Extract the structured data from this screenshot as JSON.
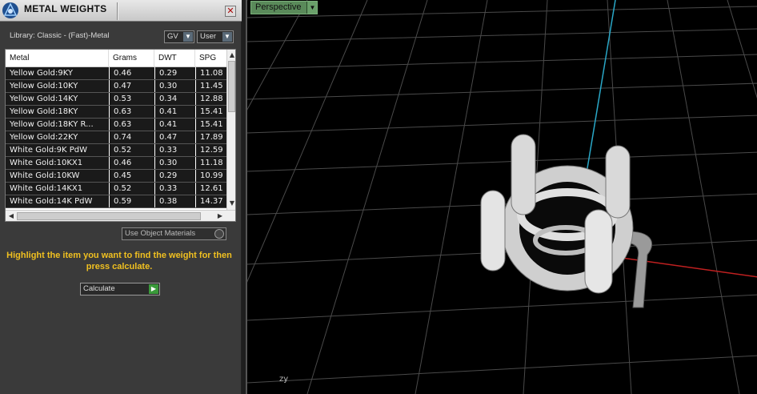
{
  "panel": {
    "title": "METAL WEIGHTS",
    "close_symbol": "✕",
    "library_label": "Library: Classic - (Fast)-Metal",
    "gv_dropdown": "GV",
    "user_dropdown": "User",
    "table": {
      "columns": [
        "Metal",
        "Grams",
        "DWT",
        "SPG"
      ],
      "rows": [
        [
          "Yellow Gold:9KY",
          "0.46",
          "0.29",
          "11.08"
        ],
        [
          "Yellow Gold:10KY",
          "0.47",
          "0.30",
          "11.45"
        ],
        [
          "Yellow Gold:14KY",
          "0.53",
          "0.34",
          "12.88"
        ],
        [
          "Yellow Gold:18KY",
          "0.63",
          "0.41",
          "15.41"
        ],
        [
          "Yellow Gold:18KY R...",
          "0.63",
          "0.41",
          "15.41"
        ],
        [
          "Yellow Gold:22KY",
          "0.74",
          "0.47",
          "17.89"
        ],
        [
          "White Gold:9K PdW",
          "0.52",
          "0.33",
          "12.59"
        ],
        [
          "White Gold:10KX1",
          "0.46",
          "0.30",
          "11.18"
        ],
        [
          "White Gold:10KW",
          "0.45",
          "0.29",
          "10.99"
        ],
        [
          "White Gold:14KX1",
          "0.52",
          "0.33",
          "12.61"
        ],
        [
          "White Gold:14K PdW",
          "0.59",
          "0.38",
          "14.37"
        ]
      ]
    },
    "use_object_materials": "Use Object Materials",
    "instructions": "Highlight the item you want to find the weight for then press calculate.",
    "calculate_label": "Calculate"
  },
  "viewport": {
    "view_name": "Perspective",
    "axis_label": "zy",
    "colors": {
      "background": "#000000",
      "grid": "#4a4a4a",
      "x_axis": "#c02020",
      "y_axis": "#2aa8c8",
      "model": "#e6e6e6"
    }
  },
  "icons": [
    "app-logo-icon",
    "close-icon",
    "chevron-down-icon",
    "scroll-up-icon",
    "scroll-down-icon",
    "scroll-left-icon",
    "scroll-right-icon",
    "play-arrow-icon"
  ]
}
